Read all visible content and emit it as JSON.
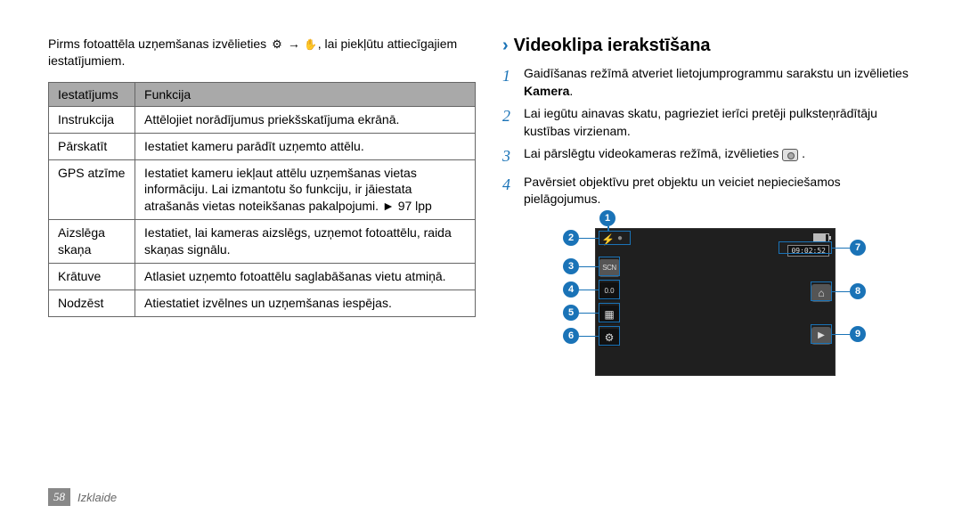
{
  "intro": "Pirms fotoattēla uzņemšanas izvēlieties ⚙ → ✋, lai piekļūtu attiecīgajiem iestatījumiem.",
  "table": {
    "headers": {
      "setting": "Iestatījums",
      "function": "Funkcija"
    },
    "rows": [
      {
        "setting": "Instrukcija",
        "function": "Attēlojiet norādījumus priekšskatījuma ekrānā."
      },
      {
        "setting": "Pārskatīt",
        "function": "Iestatiet kameru parādīt uzņemto attēlu."
      },
      {
        "setting": "GPS atzīme",
        "function": "Iestatiet kameru iekļaut attēlu uzņemšanas vietas informāciju. Lai izmantotu šo funkciju, ir jāiestata atrašanās vietas noteikšanas pakalpojumi. ► 97 lpp"
      },
      {
        "setting": "Aizslēga skaņa",
        "function": "Iestatiet, lai kameras aizslēgs, uzņemot fotoattēlu, raida skaņas signālu."
      },
      {
        "setting": "Krātuve",
        "function": "Atlasiet uzņemto fotoattēlu saglabāšanas vietu atmiņā."
      },
      {
        "setting": "Nodzēst",
        "function": "Atiestatiet izvēlnes un uzņemšanas iespējas."
      }
    ]
  },
  "heading": "Videoklipa ierakstīšana",
  "steps": [
    {
      "n": "1",
      "text": "Gaidīšanas režīmā atveriet lietojumprogrammu sarakstu un izvēlieties ",
      "bold": "Kamera",
      "suffix": "."
    },
    {
      "n": "2",
      "text": "Lai iegūtu ainavas skatu, pagrieziet ierīci pretēji pulksteņrādītāju kustības virzienam."
    },
    {
      "n": "3",
      "text": "Lai pārslēgtu videokameras režīmā, izvēlieties ",
      "icon": "camera",
      "suffix": " ."
    },
    {
      "n": "4",
      "text": "Pavērsiet objektīvu pret objektu un veiciet nepieciešamos pielāgojumus."
    }
  ],
  "diagram": {
    "timer": "09:02:52",
    "exposure": "0.0",
    "scene": "SCN"
  },
  "footer": {
    "page": "58",
    "section": "Izklaide"
  }
}
